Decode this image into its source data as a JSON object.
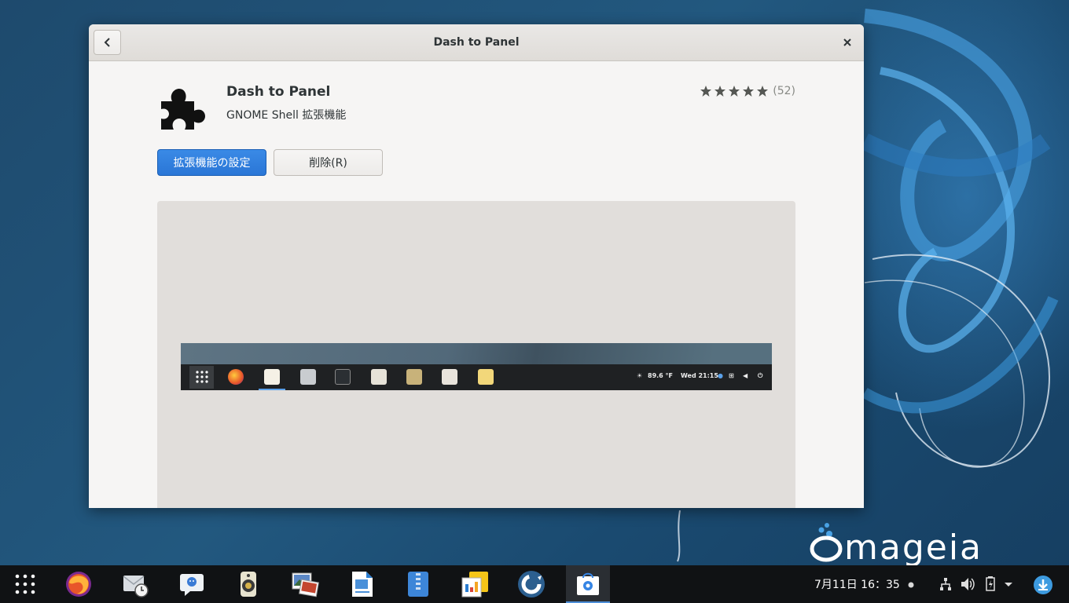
{
  "window": {
    "title": "Dash to Panel",
    "back_icon": "chevron-left-icon",
    "close_icon": "close-icon"
  },
  "app": {
    "name": "Dash to Panel",
    "summary": "GNOME Shell 拡張機能",
    "icon": "puzzle-piece-icon",
    "rating": {
      "stars": 5,
      "max": 5,
      "review_count": "(52)"
    },
    "buttons": {
      "settings_label": "拡張機能の設定",
      "remove_label": "削除(R)"
    }
  },
  "preview": {
    "weather": "89.6 °F",
    "clock": "Wed 21:15"
  },
  "taskbar": {
    "apps": [
      "app-grid-icon",
      "firefox-icon",
      "mail-clock-icon",
      "chat-icon",
      "speaker-icon",
      "image-viewer-icon",
      "document-viewer-icon",
      "archive-icon",
      "files-icon",
      "software-update-icon",
      "software-store-icon"
    ],
    "clock": "7月11日  16：35",
    "system_icons": [
      "network-icon",
      "volume-icon",
      "battery-icon",
      "menu-arrow-icon",
      "download-icon"
    ]
  },
  "branding": {
    "logo_text": "mageia"
  },
  "colors": {
    "accent": "#3584e4",
    "desktop": "#1e4a6d",
    "panel": "#101214"
  }
}
